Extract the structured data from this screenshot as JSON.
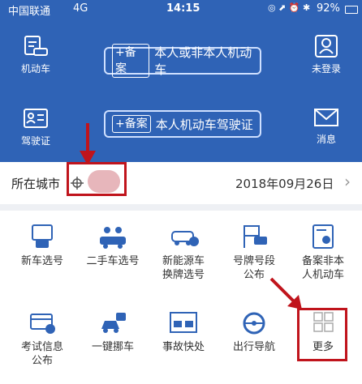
{
  "status_bar": {
    "carrier": "中国联通",
    "network": "4G",
    "time": "14:15",
    "battery": "92%"
  },
  "header_tiles": [
    {
      "label": "机动车"
    },
    {
      "label": "未登录"
    },
    {
      "label": "驾驶证"
    },
    {
      "label": "消息"
    }
  ],
  "banners": [
    {
      "tag": "+备案",
      "text": "本人或非本人机动车"
    },
    {
      "tag": "+备案",
      "text": "本人机动车驾驶证"
    }
  ],
  "city": {
    "label": "所在城市",
    "date": "2018年09月26日"
  },
  "services": [
    {
      "line1": "新车选号",
      "line2": "",
      "icon": "car-screen-icon"
    },
    {
      "line1": "二手车选号",
      "line2": "",
      "icon": "used-car-icon"
    },
    {
      "line1": "新能源车",
      "line2": "换牌选号",
      "icon": "ev-car-icon"
    },
    {
      "line1": "号牌号段",
      "line2": "公布",
      "icon": "plate-flag-icon"
    },
    {
      "line1": "备案非本",
      "line2": "人机动车",
      "icon": "document-icon"
    },
    {
      "line1": "考试信息",
      "line2": "公布",
      "icon": "exam-card-icon"
    },
    {
      "line1": "一键挪车",
      "line2": "",
      "icon": "move-car-icon"
    },
    {
      "line1": "事故快处",
      "line2": "",
      "icon": "accident-icon"
    },
    {
      "line1": "出行导航",
      "line2": "",
      "icon": "steering-wheel-icon"
    },
    {
      "line1": "更多",
      "line2": "",
      "icon": "more-grid-icon"
    }
  ],
  "colors": {
    "header_bg": "#2f63b6",
    "icon_blue": "#2f63b6",
    "annotation_red": "#c0141c"
  }
}
